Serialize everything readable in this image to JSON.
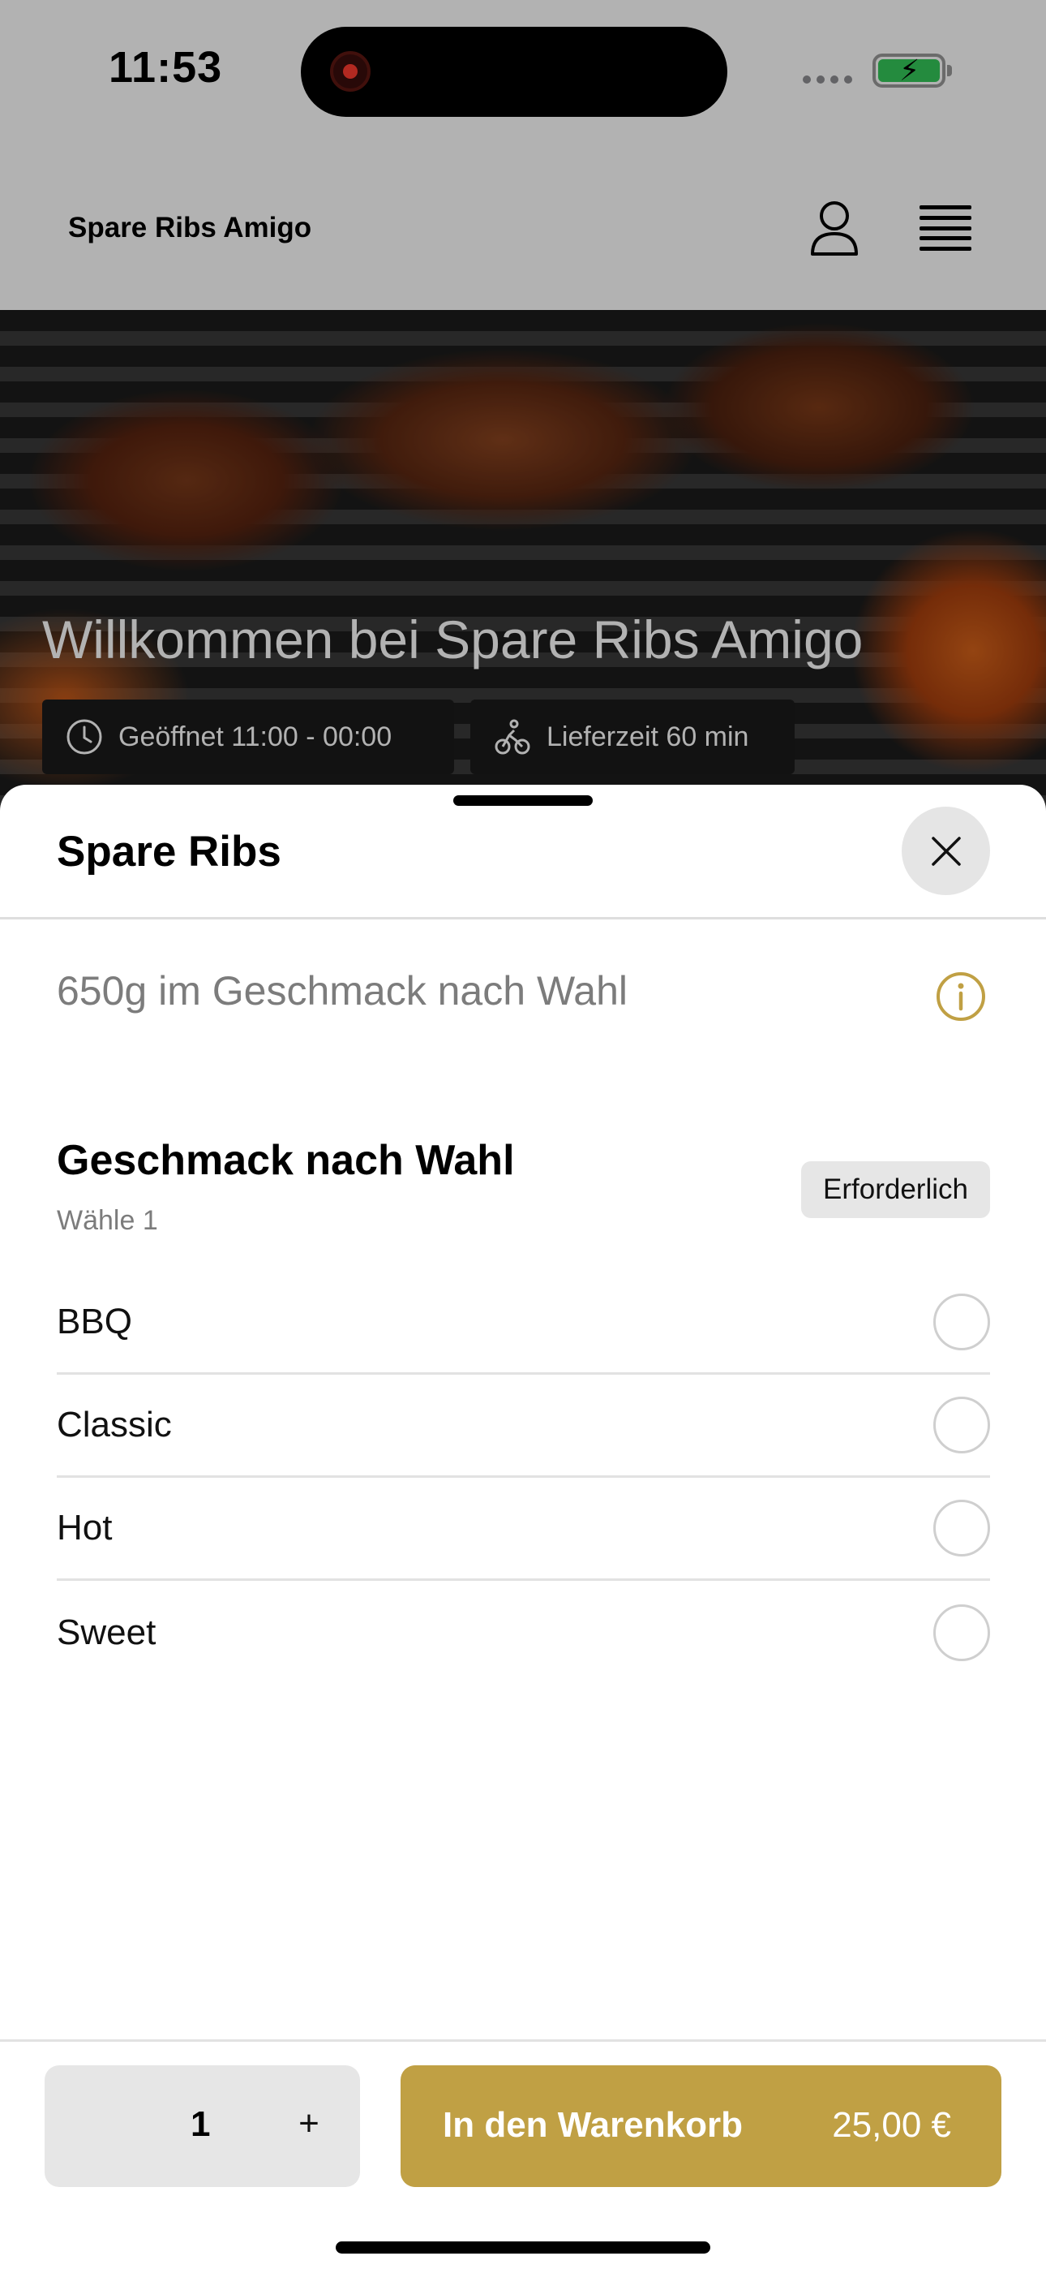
{
  "status_bar": {
    "time": "11:53"
  },
  "header": {
    "brand": "Spare Ribs Amigo"
  },
  "hero": {
    "title": "Willkommen bei Spare Ribs Amigo",
    "opening_hours": "Geöffnet 11:00 - 00:00",
    "delivery_time": "Lieferzeit 60 min"
  },
  "sheet": {
    "title": "Spare Ribs",
    "description": "650g im Geschmack nach Wahl",
    "group": {
      "title": "Geschmack nach Wahl",
      "subtitle": "Wähle 1",
      "badge": "Erforderlich",
      "options": [
        {
          "label": "BBQ",
          "selected": false
        },
        {
          "label": "Classic",
          "selected": false
        },
        {
          "label": "Hot",
          "selected": false
        },
        {
          "label": "Sweet",
          "selected": false
        }
      ]
    },
    "footer": {
      "quantity": "1",
      "plus_label": "+",
      "cart_label": "In den Warenkorb",
      "price": "25,00 €"
    }
  },
  "colors": {
    "accent": "#c0a044",
    "battery": "#34c759",
    "recording": "#ff3b30"
  }
}
